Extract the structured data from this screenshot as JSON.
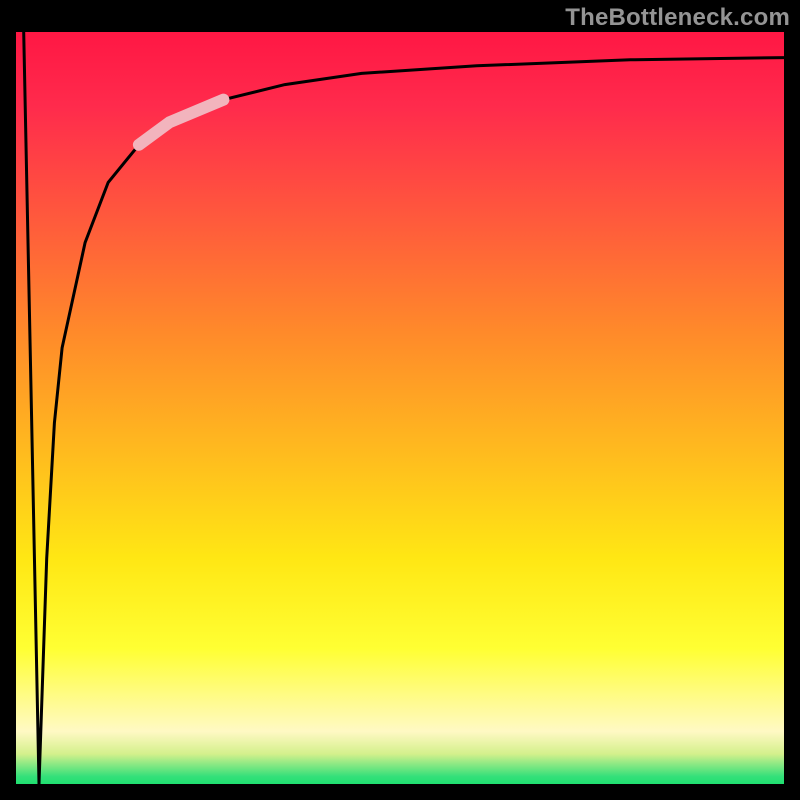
{
  "watermark": "TheBottleneck.com",
  "colors": {
    "frame": "#000000",
    "watermark_text": "#949494",
    "gradient_top": "#ff1744",
    "gradient_mid1": "#ff8a2a",
    "gradient_mid2": "#ffe714",
    "gradient_light": "#fff9c4",
    "gradient_bottom": "#1fe070",
    "curve_stroke": "#000000",
    "highlight_stroke": "#f2b4bd"
  },
  "chart_data": {
    "type": "line",
    "title": "",
    "xlabel": "",
    "ylabel": "",
    "xlim": [
      0,
      100
    ],
    "ylim": [
      0,
      100
    ],
    "grid": false,
    "legend": false,
    "series": [
      {
        "name": "curve",
        "x": [
          1,
          2,
          3,
          4,
          5,
          6,
          9,
          12,
          16,
          20,
          27,
          35,
          45,
          60,
          80,
          100
        ],
        "y": [
          100,
          50,
          0,
          30,
          48,
          58,
          72,
          80,
          85,
          88,
          91,
          93,
          94.5,
          95.5,
          96.3,
          96.6
        ]
      }
    ],
    "highlight_segment": {
      "series": "curve",
      "x_start": 16,
      "x_end": 27
    }
  }
}
